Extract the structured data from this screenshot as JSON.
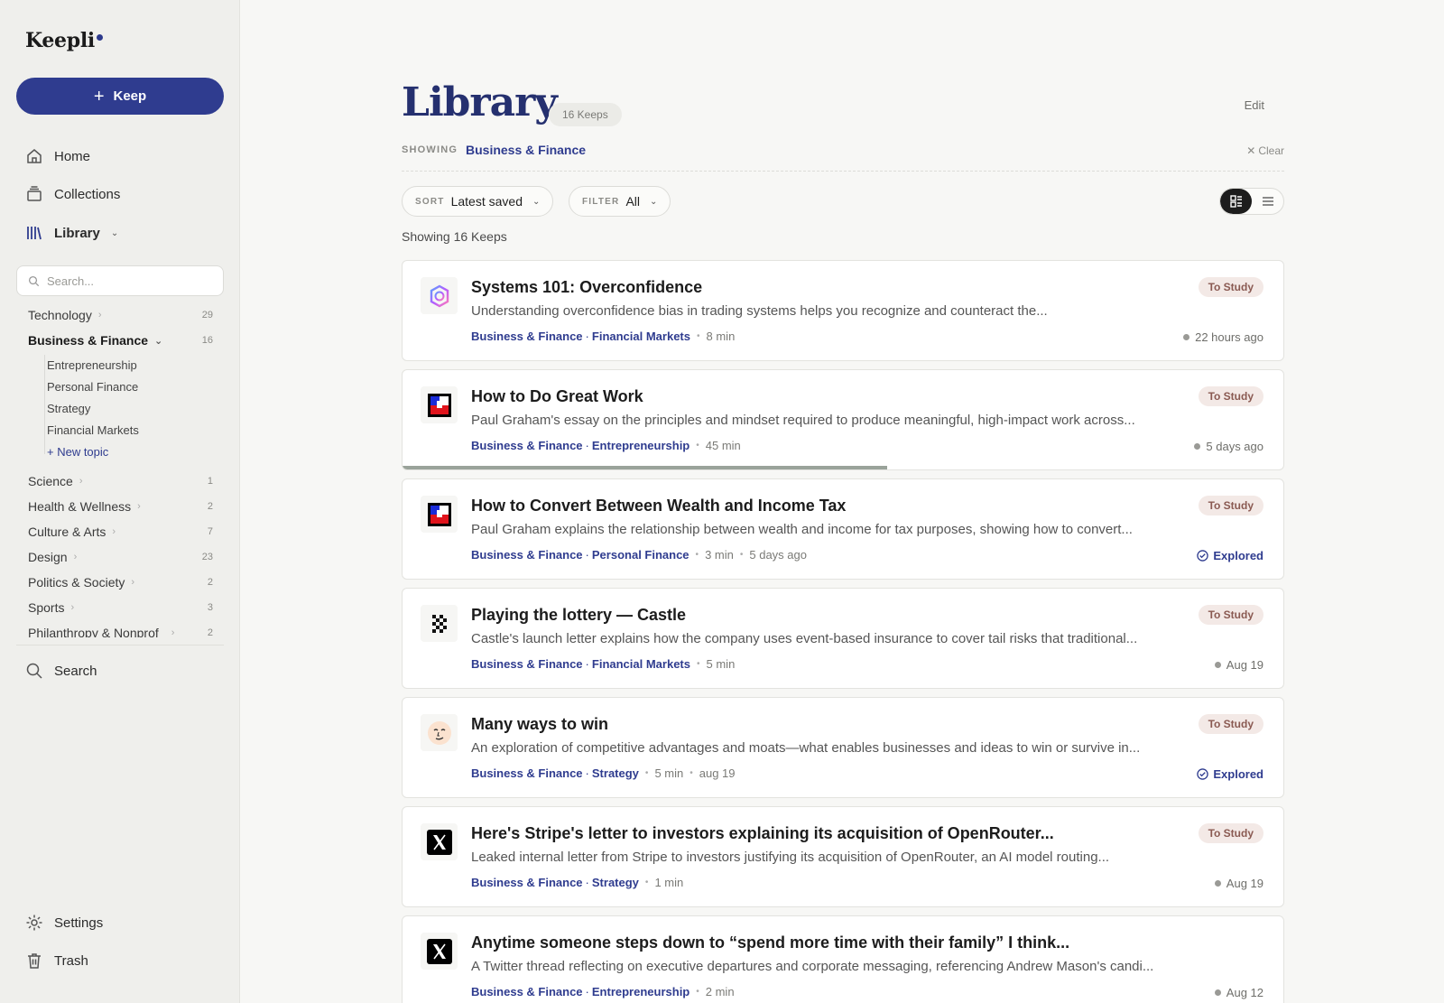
{
  "sidebar": {
    "logo": "Keepli",
    "keep_button": "Keep",
    "nav": {
      "home": "Home",
      "collections": "Collections",
      "library": "Library"
    },
    "search_placeholder": "Search...",
    "topics": [
      {
        "label": "Technology",
        "count": "29"
      },
      {
        "label": "Business & Finance",
        "count": "16"
      },
      {
        "label": "Science",
        "count": "1"
      },
      {
        "label": "Health & Wellness",
        "count": "2"
      },
      {
        "label": "Culture & Arts",
        "count": "7"
      },
      {
        "label": "Design",
        "count": "23"
      },
      {
        "label": "Politics & Society",
        "count": "2"
      },
      {
        "label": "Sports",
        "count": "3"
      },
      {
        "label": "Philanthropy & Nonprof",
        "count": "2"
      }
    ],
    "sub_topics": [
      "Entrepreneurship",
      "Personal Finance",
      "Strategy",
      "Financial Markets"
    ],
    "new_topic": "+ New topic",
    "bottom": {
      "search": "Search",
      "settings": "Settings",
      "trash": "Trash"
    }
  },
  "main": {
    "title": "Library",
    "keeps_badge": "16 Keeps",
    "edit": "Edit",
    "showing_label": "SHOWING",
    "showing_value": "Business & Finance",
    "clear": "Clear",
    "sort_label": "SORT",
    "sort_value": "Latest saved",
    "filter_label": "FILTER",
    "filter_value": "All",
    "count_text": "Showing 16 Keeps"
  },
  "cards": [
    {
      "title": "Systems 101: Overconfidence",
      "desc": "Understanding overconfidence bias in trading systems helps you recognize and counteract the...",
      "cat": "Business & Finance",
      "sub": "Financial Markets",
      "dur": "8 min",
      "extra": "",
      "status": "To Study",
      "when": "22 hours ago",
      "explored": "",
      "icon": "swirl-logo-icon"
    },
    {
      "title": "How to Do Great Work",
      "desc": "Paul Graham's essay on the principles and mindset required to produce meaningful, high-impact work across...",
      "cat": "Business & Finance",
      "sub": "Entrepreneurship",
      "dur": "45 min",
      "extra": "",
      "status": "To Study",
      "when": "5 days ago",
      "explored": "",
      "icon": "paul-graham-logo-icon",
      "progress": 0.55
    },
    {
      "title": "How to Convert Between Wealth and Income Tax",
      "desc": "Paul Graham explains the relationship between wealth and income for tax purposes, showing how to convert...",
      "cat": "Business & Finance",
      "sub": "Personal Finance",
      "dur": "3 min",
      "extra": "5 days ago",
      "status": "To Study",
      "when": "",
      "explored": "Explored",
      "icon": "paul-graham-logo-icon"
    },
    {
      "title": "Playing the lottery — Castle",
      "desc": "Castle's launch letter explains how the company uses event-based insurance to cover tail risks that traditional...",
      "cat": "Business & Finance",
      "sub": "Financial Markets",
      "dur": "5 min",
      "extra": "",
      "status": "To Study",
      "when": "Aug 19",
      "explored": "",
      "icon": "checker-logo-icon"
    },
    {
      "title": "Many ways to win",
      "desc": "An exploration of competitive advantages and moats—what enables businesses and ideas to win or survive in...",
      "cat": "Business & Finance",
      "sub": "Strategy",
      "dur": "5 min",
      "extra": "aug 19",
      "status": "To Study",
      "when": "",
      "explored": "Explored",
      "icon": "face-avatar-icon"
    },
    {
      "title": "Here's Stripe's letter to investors explaining its acquisition of OpenRouter...",
      "desc": "Leaked internal letter from Stripe to investors justifying its acquisition of OpenRouter, an AI model routing...",
      "cat": "Business & Finance",
      "sub": "Strategy",
      "dur": "1 min",
      "extra": "",
      "status": "To Study",
      "when": "Aug 19",
      "explored": "",
      "icon": "x-logo-icon"
    },
    {
      "title": "Anytime someone steps down to “spend more time with their family” I think...",
      "desc": "A Twitter thread reflecting on executive departures and corporate messaging, referencing Andrew Mason's candi...",
      "cat": "Business & Finance",
      "sub": "Entrepreneurship",
      "dur": "2 min",
      "extra": "",
      "status": "",
      "when": "Aug 12",
      "explored": "",
      "icon": "x-logo-icon"
    }
  ]
}
